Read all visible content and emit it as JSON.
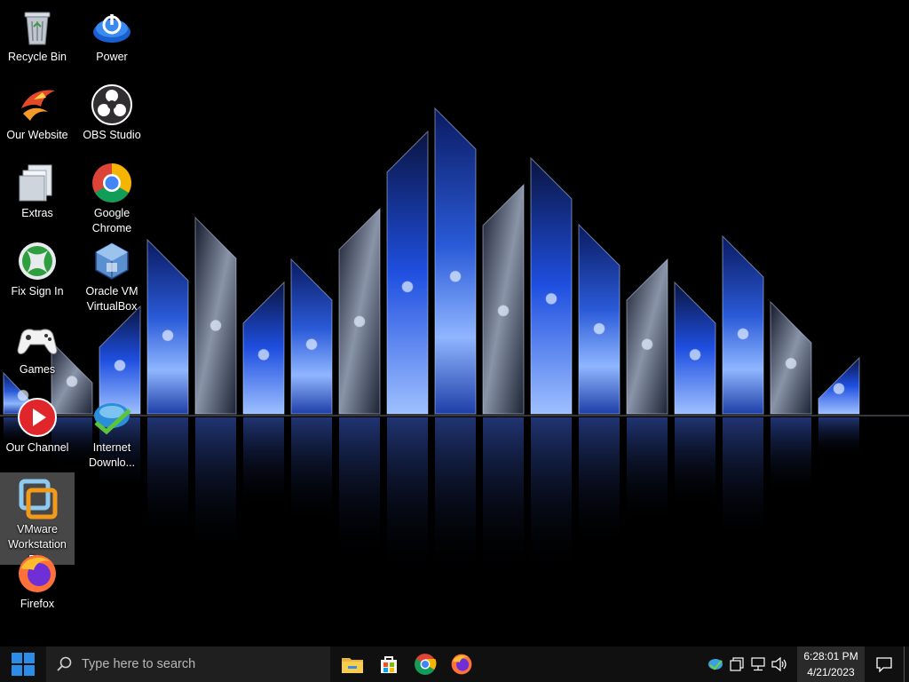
{
  "desktop": {
    "icons": [
      {
        "label": "Recycle Bin",
        "icon": "recycle-bin-icon"
      },
      {
        "label": "Power",
        "icon": "power-icon"
      },
      {
        "label": "Our Website",
        "icon": "website-icon"
      },
      {
        "label": "OBS Studio",
        "icon": "obs-icon"
      },
      {
        "label": "Extras",
        "icon": "folder-icon"
      },
      {
        "label": "Google Chrome",
        "icon": "chrome-icon"
      },
      {
        "label": "Fix Sign In",
        "icon": "xbox-icon"
      },
      {
        "label": "Oracle VM VirtualBox",
        "icon": "virtualbox-icon"
      },
      {
        "label": "Games",
        "icon": "gamepad-icon"
      },
      {
        "label": "Our Channel",
        "icon": "youtube-icon"
      },
      {
        "label": "Internet Downlo...",
        "icon": "idm-icon"
      },
      {
        "label": "VMware Workstation Pro",
        "icon": "vmware-icon"
      },
      {
        "label": "Firefox",
        "icon": "firefox-icon"
      }
    ]
  },
  "taskbar": {
    "search_placeholder": "Type here to search",
    "pinned": [
      "file-explorer-icon",
      "store-icon",
      "chrome-icon",
      "firefox-icon"
    ],
    "tray_icons": [
      "idm-tray-icon",
      "taskview-icon",
      "network-icon",
      "volume-icon"
    ],
    "time": "6:28:01 PM",
    "date": "4/21/2023"
  },
  "colors": {
    "taskbar_bg": "#101010",
    "search_bg": "#1f1f1f",
    "windows_blue": "#2b8de8",
    "wallpaper_blue": "#3a6fe0"
  }
}
